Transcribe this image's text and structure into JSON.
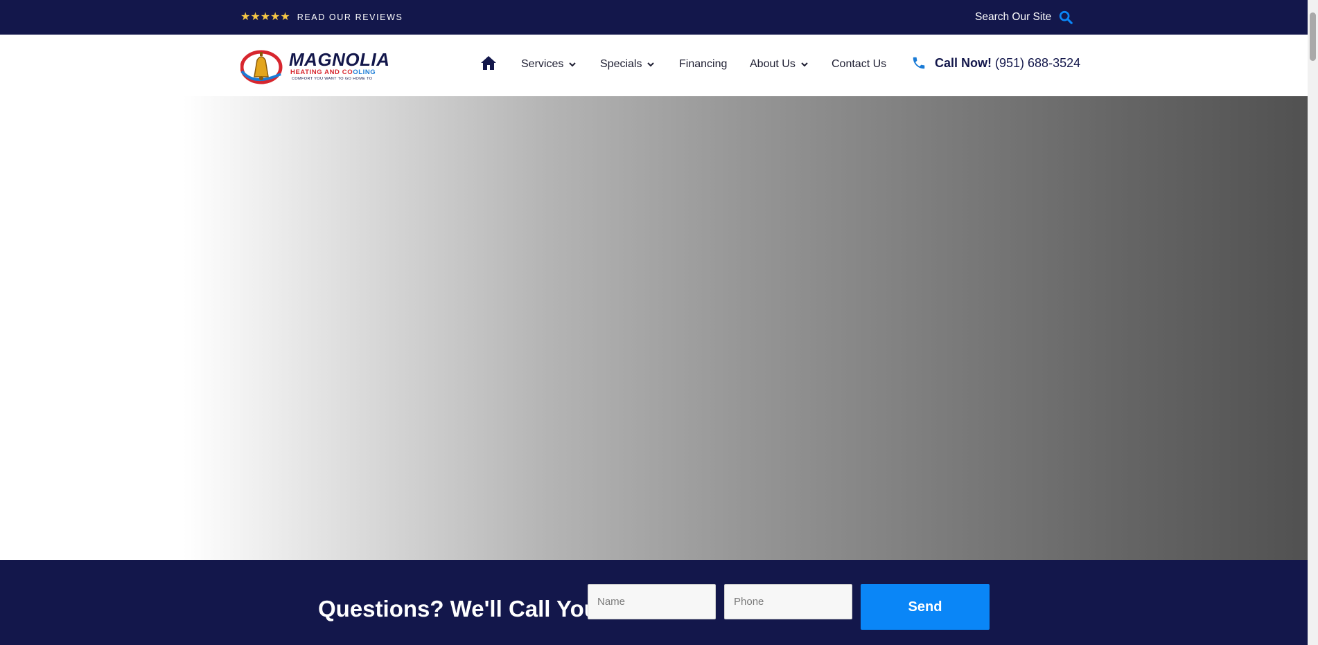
{
  "colors": {
    "navy": "#13174b",
    "accent_blue": "#0a86f7",
    "star_gold": "#f6c744",
    "logo_red": "#d7262e"
  },
  "topbar": {
    "stars": "★★★★★",
    "reviews_label": "READ OUR REVIEWS",
    "search_label": "Search Our Site",
    "search_icon": "search-icon"
  },
  "logo": {
    "name": "MAGNOLIA",
    "sub_red": "HEATING AND CO",
    "sub_blue": "OLING",
    "tagline": "COMFORT YOU WANT TO GO HOME TO"
  },
  "nav": {
    "home_icon": "home-icon",
    "items": [
      {
        "label": "Services",
        "has_dropdown": true
      },
      {
        "label": "Specials",
        "has_dropdown": true
      },
      {
        "label": "Financing",
        "has_dropdown": false
      },
      {
        "label": "About Us",
        "has_dropdown": true
      },
      {
        "label": "Contact Us",
        "has_dropdown": false
      }
    ],
    "call_label": "Call Now!",
    "call_number": "(951) 688-3524"
  },
  "callback": {
    "title": "Questions? We'll Call You!",
    "name_placeholder": "Name",
    "phone_placeholder": "Phone",
    "send_label": "Send"
  }
}
